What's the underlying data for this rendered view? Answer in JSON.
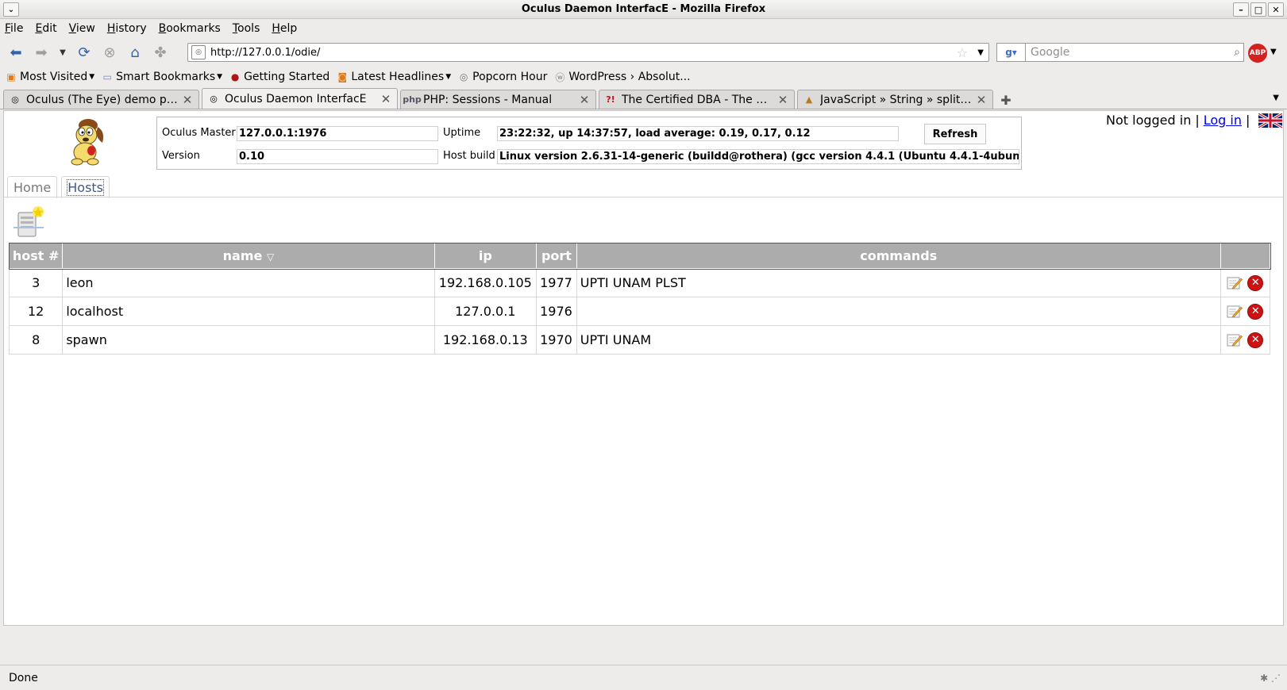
{
  "window": {
    "title": "Oculus Daemon InterfacE - Mozilla Firefox"
  },
  "menu": [
    "File",
    "Edit",
    "View",
    "History",
    "Bookmarks",
    "Tools",
    "Help"
  ],
  "nav": {
    "url": "http://127.0.0.1/odie/",
    "search_placeholder": "Google"
  },
  "bookmarks": [
    {
      "label": "Most Visited",
      "dropdown": true
    },
    {
      "label": "Smart Bookmarks",
      "dropdown": true
    },
    {
      "label": "Getting Started",
      "dropdown": false
    },
    {
      "label": "Latest Headlines",
      "dropdown": true
    },
    {
      "label": "Popcorn Hour",
      "dropdown": false
    },
    {
      "label": "WordPress › Absolut...",
      "dropdown": false
    }
  ],
  "tabs": [
    {
      "label": "Oculus (The Eye) demo page",
      "active": false
    },
    {
      "label": "Oculus Daemon InterfacE",
      "active": true
    },
    {
      "label": "PHP: Sessions - Manual",
      "active": false
    },
    {
      "label": "The Certified DBA - The Dail...",
      "active": false
    },
    {
      "label": "JavaScript » String » split - D...",
      "active": false
    }
  ],
  "info": {
    "master_label": "Oculus Master",
    "master_value": "127.0.0.1:1976",
    "uptime_label": "Uptime",
    "uptime_value": "23:22:32, up 14:37:57, load average: 0.19, 0.17, 0.12",
    "version_label": "Version",
    "version_value": "0.10",
    "hostbuild_label": "Host build",
    "hostbuild_value": "Linux version 2.6.31-14-generic (buildd@rothera) (gcc version 4.4.1 (Ubuntu 4.4.1-4ubun",
    "refresh_label": "Refresh"
  },
  "login": {
    "status": "Not logged in",
    "separator": "|",
    "login_link": "Log in"
  },
  "page_tabs": {
    "home": "Home",
    "hosts": "Hosts"
  },
  "table": {
    "headers": {
      "host": "host #",
      "name": "name",
      "sort": "▽",
      "ip": "ip",
      "port": "port",
      "commands": "commands"
    },
    "rows": [
      {
        "host": "3",
        "name": "leon",
        "ip": "192.168.0.105",
        "port": "1977",
        "commands": "UPTI UNAM PLST"
      },
      {
        "host": "12",
        "name": "localhost",
        "ip": "127.0.0.1",
        "port": "1976",
        "commands": ""
      },
      {
        "host": "8",
        "name": "spawn",
        "ip": "192.168.0.13",
        "port": "1970",
        "commands": "UPTI UNAM"
      }
    ]
  },
  "status": "Done"
}
